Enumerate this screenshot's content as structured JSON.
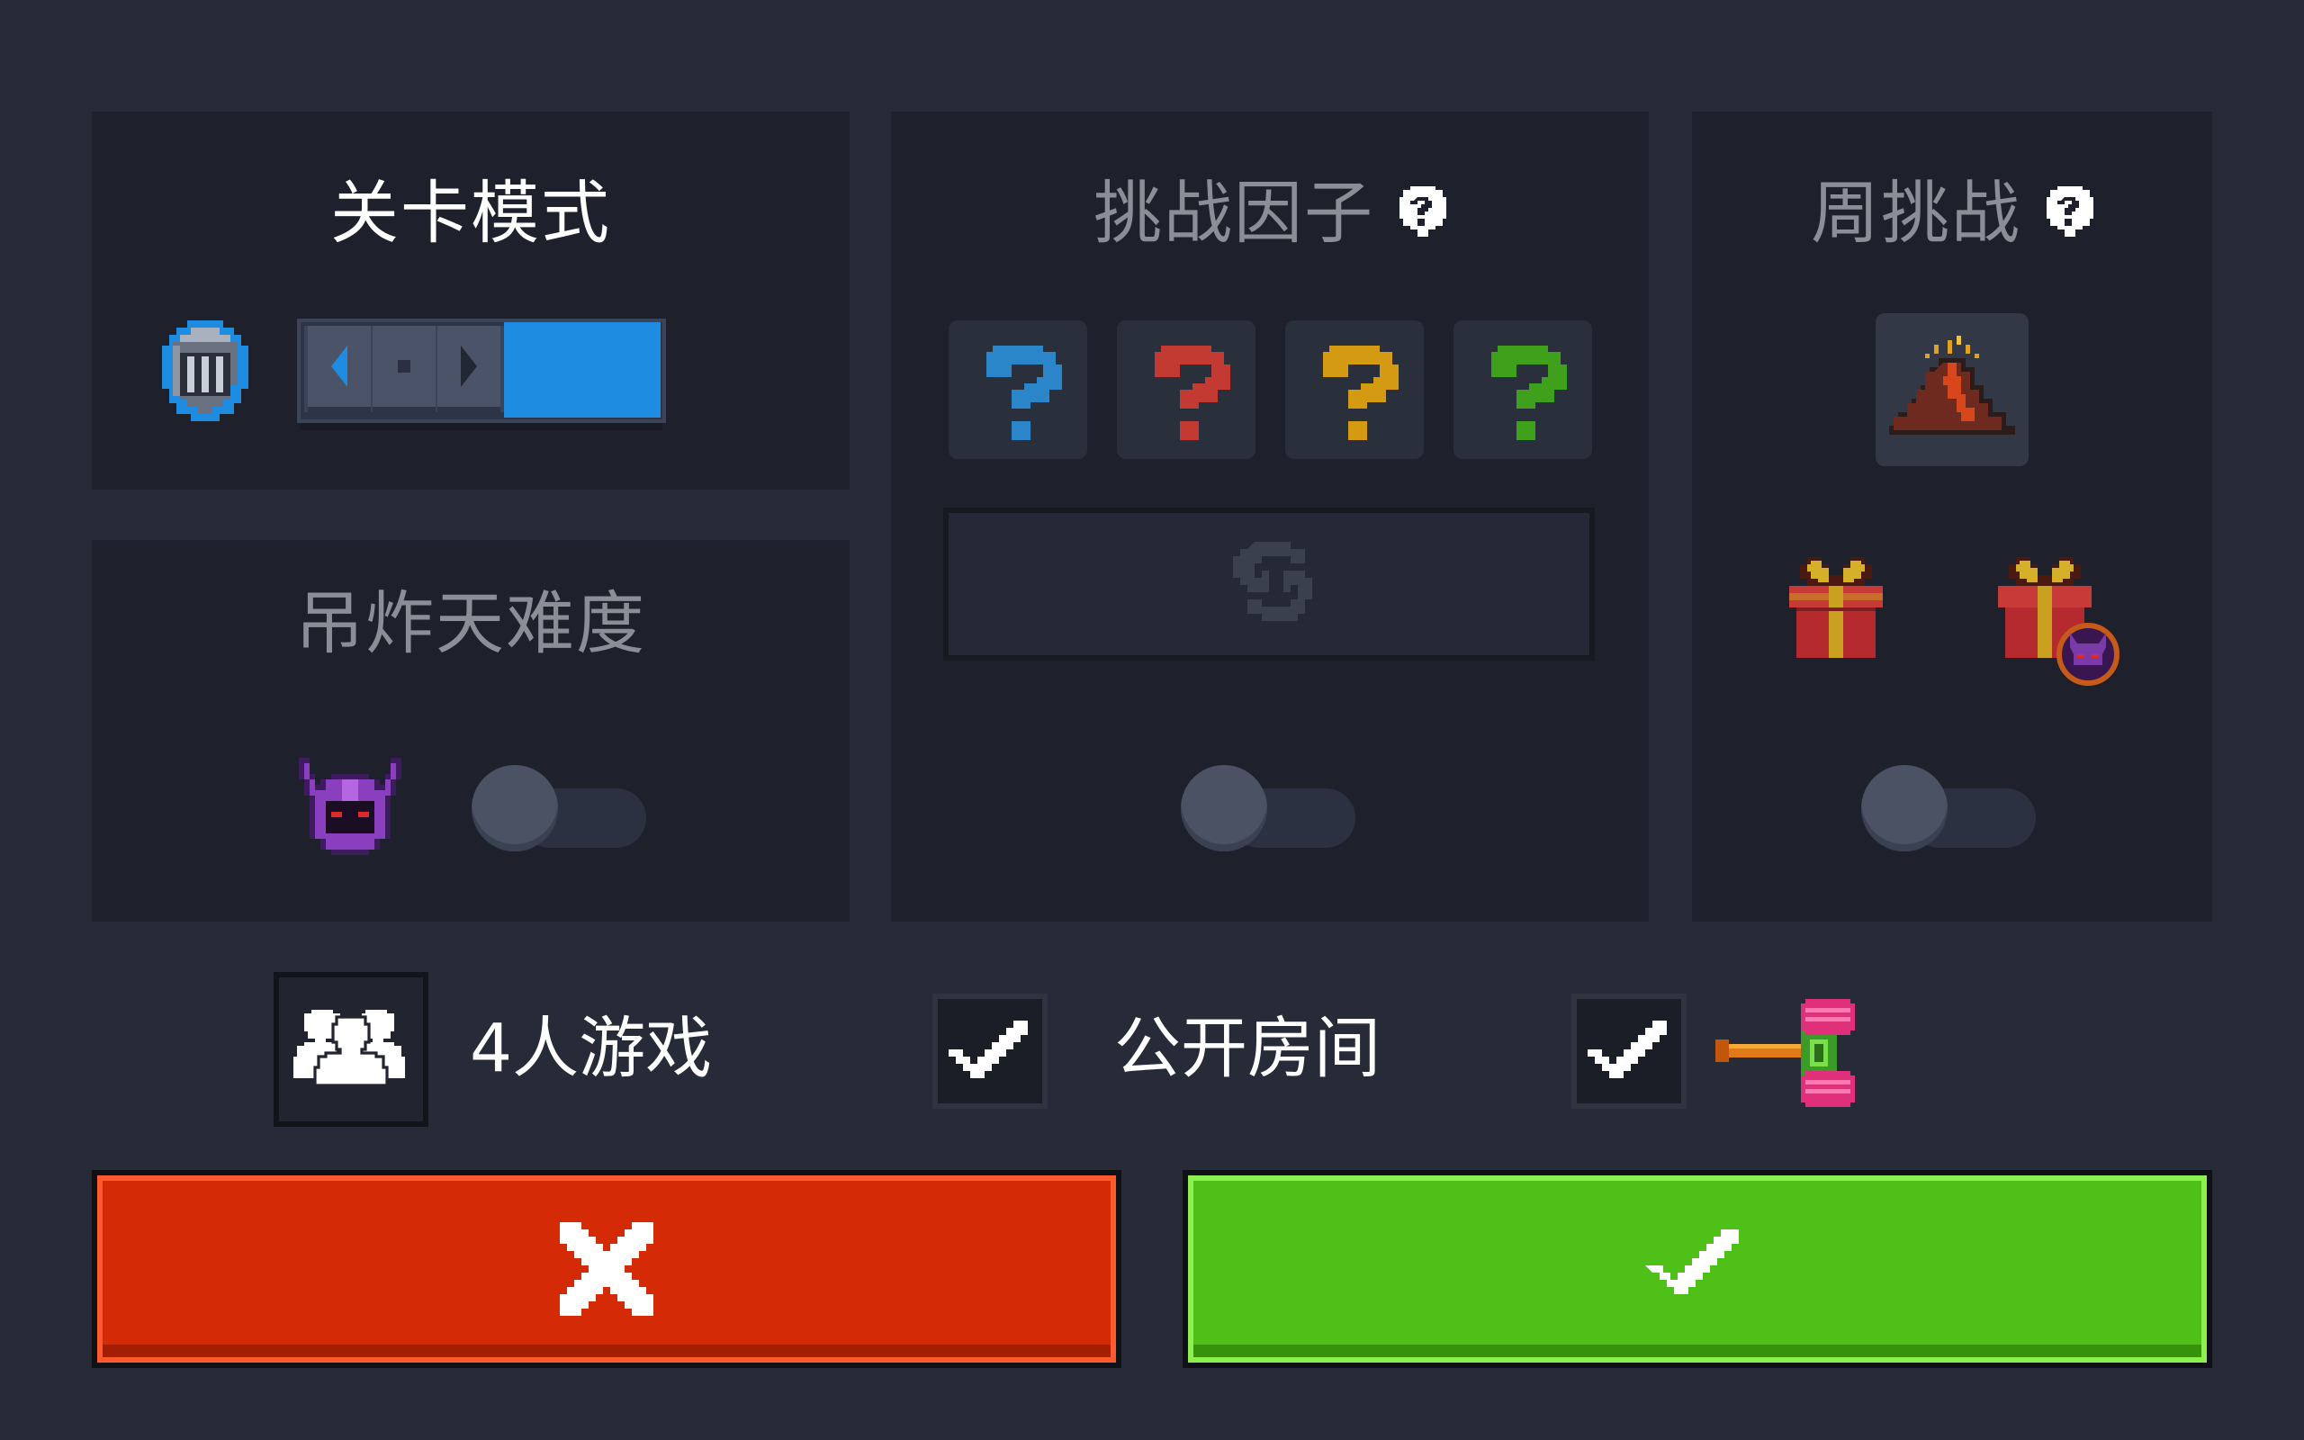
{
  "panels": {
    "level_mode": {
      "title": "关卡模式",
      "slider_position": "right"
    },
    "hard_mode": {
      "title": "吊炸天难度",
      "enabled": false
    },
    "challenge_factor": {
      "title": "挑战因子",
      "help_icon": "question-icon",
      "slots": [
        "blue",
        "red",
        "yellow",
        "green"
      ],
      "enabled": false
    },
    "weekly_challenge": {
      "title": "周挑战",
      "help_icon": "question-icon",
      "enabled": false
    }
  },
  "options": {
    "players": {
      "label": "4人游戏",
      "icon": "players-icon"
    },
    "public_room": {
      "label": "公开房间",
      "checked": true
    },
    "hammer": {
      "checked": true,
      "icon": "hammer-icon"
    }
  },
  "colors": {
    "cancel": "#d42a06",
    "confirm": "#4ec018",
    "accent_blue": "#1e8ce0",
    "q_blue": "#2a86c8",
    "q_red": "#c23a32",
    "q_yellow": "#d49a12",
    "q_green": "#3fa01c"
  }
}
